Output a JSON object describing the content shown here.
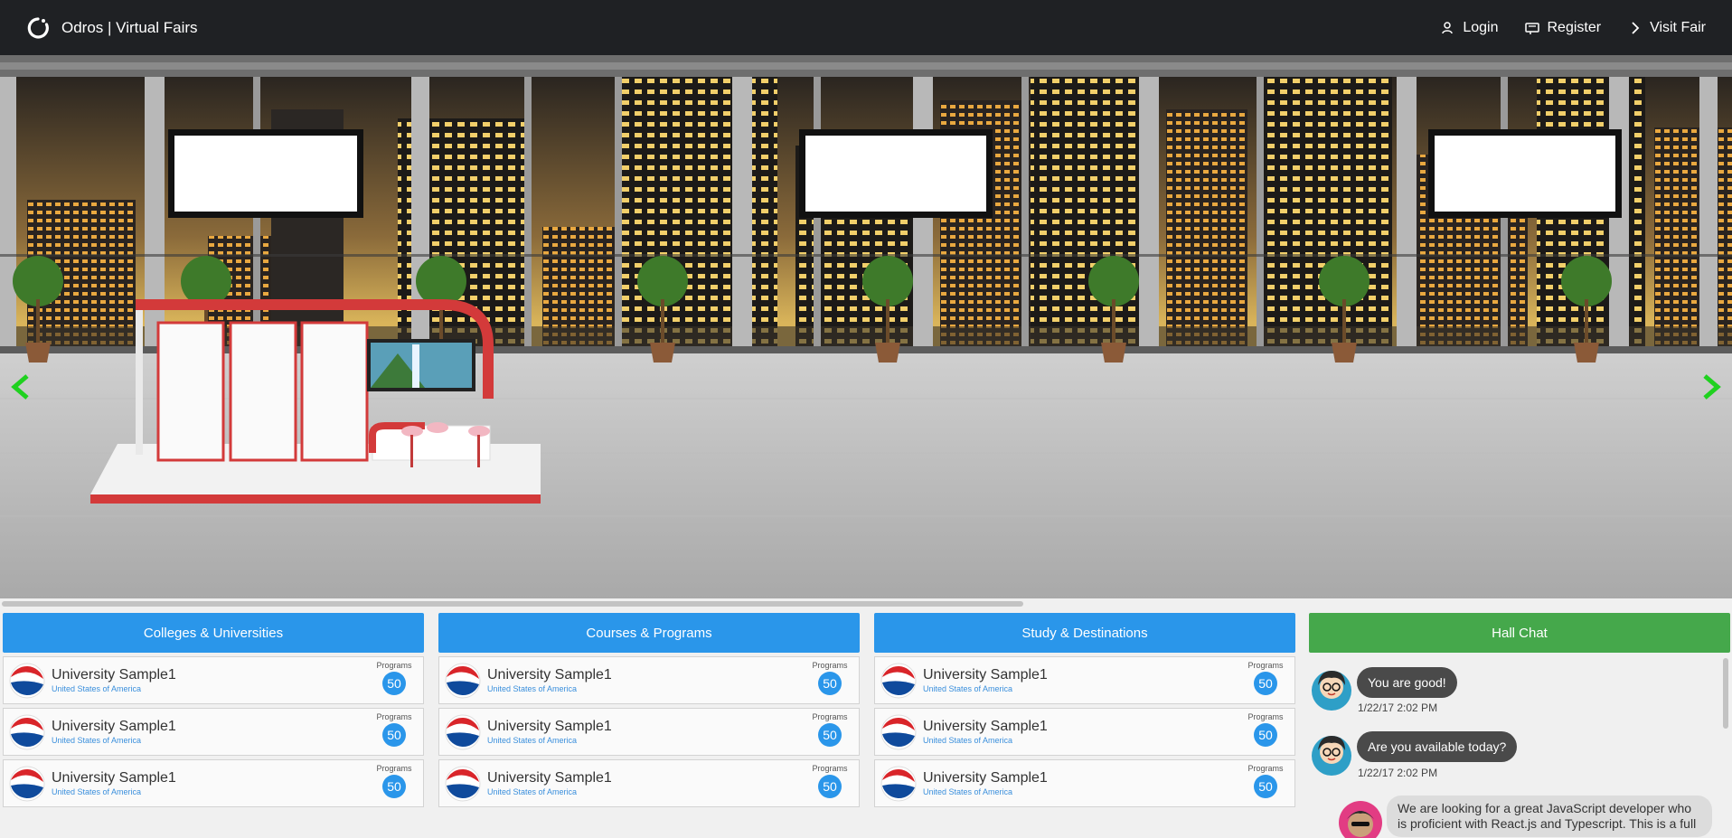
{
  "navbar": {
    "brand": "Odros | Virtual Fairs",
    "links": [
      {
        "label": "Login",
        "icon": "user-key-icon"
      },
      {
        "label": "Register",
        "icon": "id-card-icon"
      },
      {
        "label": "Visit Fair",
        "icon": "chevron-right-icon"
      }
    ]
  },
  "hall": {
    "arrow_color": "#1fd11f"
  },
  "panels": [
    {
      "title": "Colleges & Universities",
      "items": [
        {
          "name": "University Sample1",
          "country": "United States of America",
          "programs_label": "Programs",
          "programs": "50"
        },
        {
          "name": "University Sample1",
          "country": "United States of America",
          "programs_label": "Programs",
          "programs": "50"
        },
        {
          "name": "University Sample1",
          "country": "United States of America",
          "programs_label": "Programs",
          "programs": "50"
        }
      ]
    },
    {
      "title": "Courses & Programs",
      "items": [
        {
          "name": "University Sample1",
          "country": "United States of America",
          "programs_label": "Programs",
          "programs": "50"
        },
        {
          "name": "University Sample1",
          "country": "United States of America",
          "programs_label": "Programs",
          "programs": "50"
        },
        {
          "name": "University Sample1",
          "country": "United States of America",
          "programs_label": "Programs",
          "programs": "50"
        }
      ]
    },
    {
      "title": "Study & Destinations",
      "items": [
        {
          "name": "University Sample1",
          "country": "United States of America",
          "programs_label": "Programs",
          "programs": "50"
        },
        {
          "name": "University Sample1",
          "country": "United States of America",
          "programs_label": "Programs",
          "programs": "50"
        },
        {
          "name": "University Sample1",
          "country": "United States of America",
          "programs_label": "Programs",
          "programs": "50"
        }
      ]
    }
  ],
  "chat": {
    "title": "Hall Chat",
    "messages": [
      {
        "text": "You are good!",
        "time": "1/22/17 2:02 PM"
      },
      {
        "text": "Are you available today?",
        "time": "1/22/17 2:02 PM"
      },
      {
        "text": "We are looking for a great JavaScript developer who is proficient with React.js and Typescript. This is a full"
      }
    ]
  },
  "colors": {
    "navbar": "#1f2124",
    "panel_header": "#2a96ea",
    "chat_header": "#45a84b",
    "badge": "#2a96ea"
  }
}
